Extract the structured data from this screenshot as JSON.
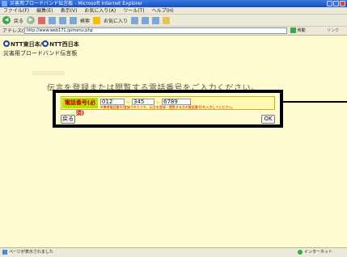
{
  "window": {
    "title": "災害用ブロードバンド伝言板 - Microsoft Internet Explorer"
  },
  "menu": [
    "ファイル(F)",
    "編集(E)",
    "表示(V)",
    "お気に入り(A)",
    "ツール(T)",
    "ヘルプ(H)"
  ],
  "toolbar": {
    "back_label": "戻る",
    "search_label": "検索",
    "favorites_label": "お気に入り"
  },
  "address": {
    "label": "アドレス(D)",
    "url": "http://www.web171.jp/menu.php",
    "go_label": "移動",
    "links_label": "リンク"
  },
  "page": {
    "brand_left": "NTT東日本",
    "brand_sep": "/",
    "brand_right": "NTT西日本",
    "subtitle": "災害用ブロードバンド伝言板",
    "instruction": "伝言を登録または閲覧する電話番号をご入力ください。",
    "phone": {
      "label": "電話番号(必須)",
      "part1": "012",
      "part2": "345",
      "part3": "6789",
      "separator": "-",
      "note": "※携帯電話番号(登録されたうち、伝言を登録・閲覧する方の電話番号)を入力してください。"
    },
    "back_button": "戻る",
    "ok_button": "OK"
  },
  "status": {
    "left": "ページが表示されました",
    "right": "インターネット"
  }
}
